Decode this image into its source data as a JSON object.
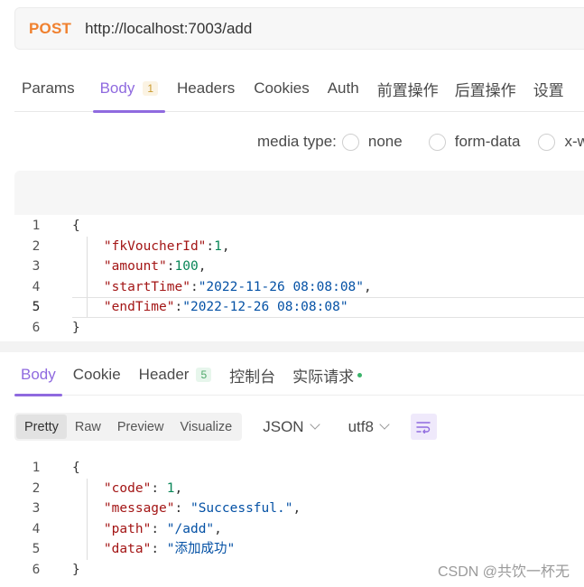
{
  "request": {
    "method": "POST",
    "url": "http://localhost:7003/add"
  },
  "request_tabs": [
    {
      "label": "Params",
      "active": false
    },
    {
      "label": "Body",
      "badge": "1",
      "active": true
    },
    {
      "label": "Headers",
      "active": false
    },
    {
      "label": "Cookies",
      "active": false
    },
    {
      "label": "Auth",
      "active": false
    },
    {
      "label": "前置操作",
      "active": false
    },
    {
      "label": "后置操作",
      "active": false
    },
    {
      "label": "设置",
      "active": false
    }
  ],
  "media_type": {
    "label": "media type:",
    "options": [
      "none",
      "form-data",
      "x-w"
    ]
  },
  "request_body": {
    "line_numbers": [
      "1",
      "2",
      "3",
      "4",
      "5",
      "6"
    ],
    "highlighted_line": "5",
    "lines": [
      {
        "open": "{"
      },
      {
        "key": "\"fkVoucherId\"",
        "sep": ":",
        "value": "1",
        "value_type": "number",
        "trail": ","
      },
      {
        "key": "\"amount\"",
        "sep": ":",
        "value": "100",
        "value_type": "number",
        "trail": ","
      },
      {
        "key": "\"startTime\"",
        "sep": ":",
        "value": "\"2022-11-26 08:08:08\"",
        "value_type": "string",
        "trail": ","
      },
      {
        "key": "\"endTime\"",
        "sep": ":",
        "value": "\"2022-12-26 08:08:08\"",
        "value_type": "string",
        "trail": ""
      },
      {
        "open": "}"
      }
    ]
  },
  "response_tabs": [
    {
      "label": "Body",
      "active": true
    },
    {
      "label": "Cookie",
      "active": false
    },
    {
      "label": "Header",
      "badge": "5",
      "active": false
    },
    {
      "label": "控制台",
      "active": false
    },
    {
      "label": "实际请求",
      "dot": true,
      "active": false
    }
  ],
  "response_format": {
    "modes": [
      "Pretty",
      "Raw",
      "Preview",
      "Visualize"
    ],
    "active_mode": "Pretty",
    "language": "JSON",
    "encoding": "utf8"
  },
  "response_body": {
    "line_numbers": [
      "1",
      "2",
      "3",
      "4",
      "5",
      "6"
    ],
    "lines": [
      {
        "open": "{"
      },
      {
        "key": "\"code\"",
        "sep": ": ",
        "value": "1",
        "value_type": "number",
        "trail": ","
      },
      {
        "key": "\"message\"",
        "sep": ": ",
        "value": "\"Successful.\"",
        "value_type": "string",
        "trail": ","
      },
      {
        "key": "\"path\"",
        "sep": ": ",
        "value": "\"/add\"",
        "value_type": "string",
        "trail": ","
      },
      {
        "key": "\"data\"",
        "sep": ": ",
        "value": "\"添加成功\"",
        "value_type": "string",
        "trail": ""
      },
      {
        "open": "}"
      }
    ]
  },
  "watermark": "CSDN @共饮一杯无",
  "colors": {
    "accent": "#8f6adf",
    "method": "#f0812f",
    "json_key": "#a31515",
    "json_number": "#098658",
    "json_string": "#0451a5"
  }
}
